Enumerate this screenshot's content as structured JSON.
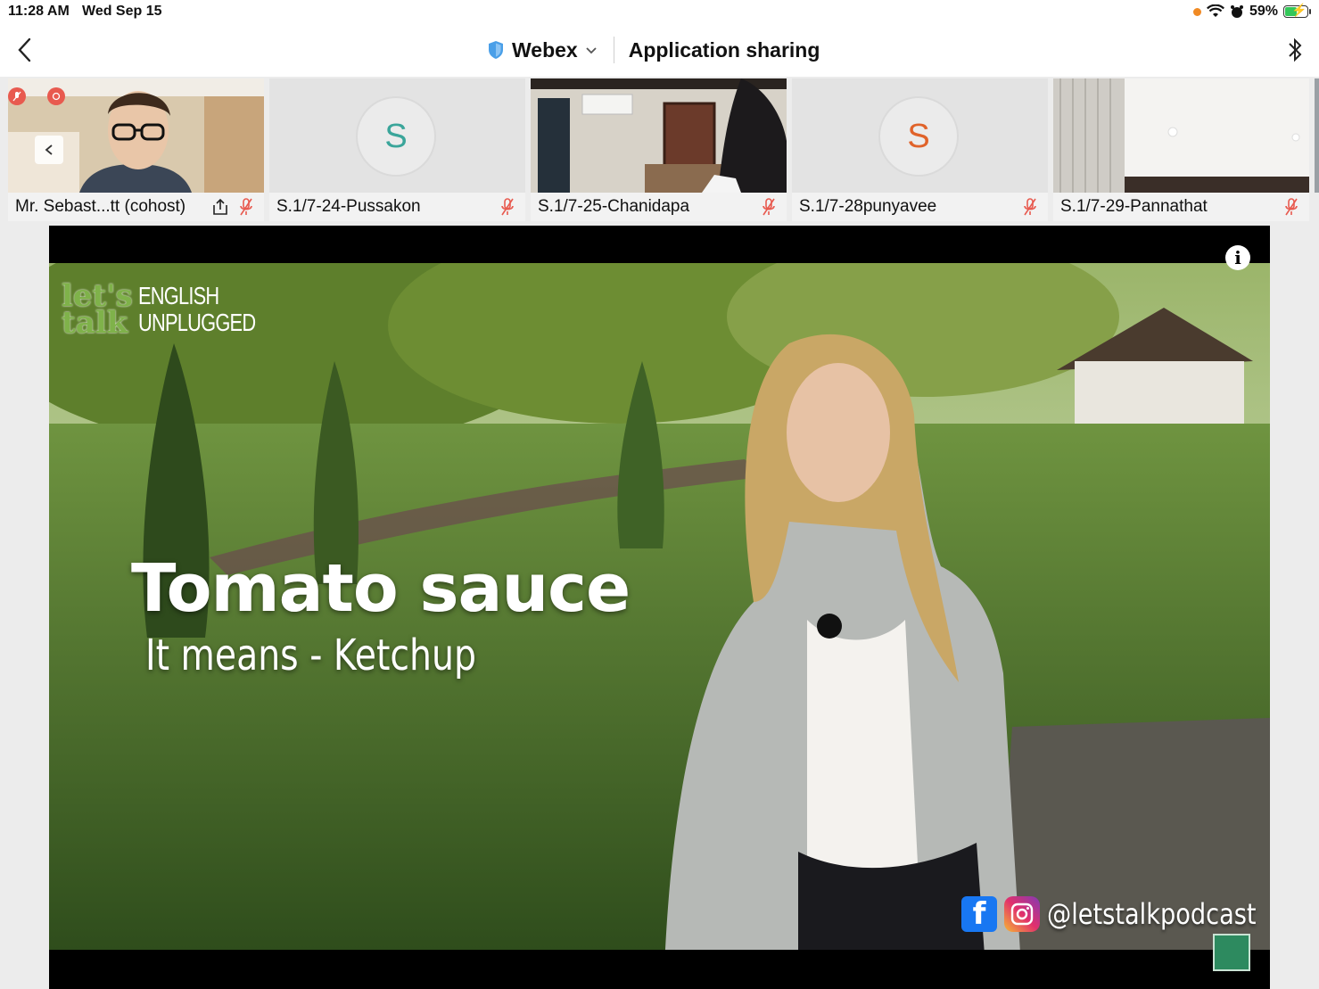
{
  "status_bar": {
    "time": "11:28 AM",
    "date": "Wed Sep 15",
    "battery": "59%",
    "battery_level": 0.59,
    "icons": [
      "orange-dot",
      "wifi-icon",
      "alarm-icon",
      "battery-icon"
    ]
  },
  "nav": {
    "app_name": "Webex",
    "title": "Application sharing",
    "icons": [
      "back-chevron-icon",
      "shield-icon",
      "chevron-down-icon",
      "bluetooth-icon"
    ]
  },
  "participants": [
    {
      "name": "Mr. Sebast...tt (cohost)",
      "muted": true,
      "sharing": true,
      "type": "video"
    },
    {
      "name": "S.1/7-24-Pussakon",
      "muted": true,
      "initial": "S",
      "initial_color": "#3aa59a",
      "type": "avatar"
    },
    {
      "name": "S.1/7-25-Chanidapa",
      "muted": true,
      "type": "video"
    },
    {
      "name": "S.1/7-28punyavee",
      "muted": true,
      "initial": "S",
      "initial_color": "#e0632a",
      "type": "avatar"
    },
    {
      "name": "S.1/7-29-Pannathat",
      "muted": true,
      "type": "video"
    }
  ],
  "shared_content": {
    "logo_main_1": "let's",
    "logo_main_2": "talk",
    "logo_sub_1": "ENGLISH",
    "logo_sub_2": "UNPLUGGED",
    "headline": "Tomato sauce",
    "subline": "It means - Ketchup",
    "social_handle": "@letstalkpodcast",
    "info_label": "i",
    "fb_letter": "f"
  },
  "colors": {
    "accent_muted": "#e85a4f",
    "webex_shield": "#4a9fe8"
  }
}
